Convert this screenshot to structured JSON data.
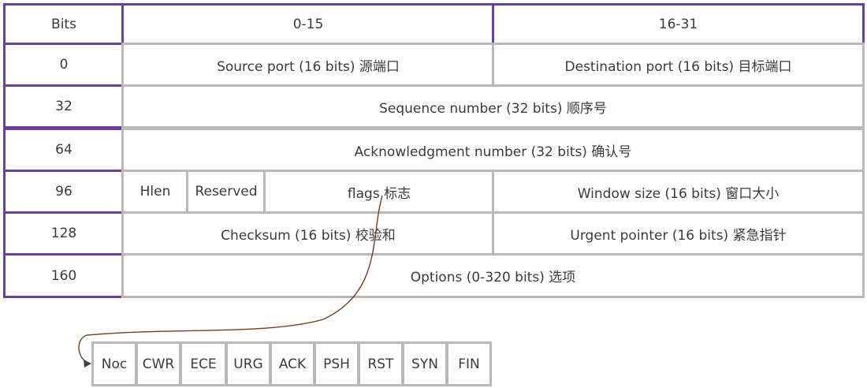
{
  "header": {
    "bits_label": "Bits",
    "col_a": "0-15",
    "col_b": "16-31"
  },
  "rows": [
    {
      "offset": "0",
      "fields": [
        "Source port (16 bits) 源端口",
        "Destination port (16 bits) 目标端口"
      ]
    },
    {
      "offset": "32",
      "fields": [
        "Sequence number (32 bits) 顺序号"
      ]
    },
    {
      "offset": "64",
      "fields": [
        "Acknowledgment number (32 bits) 确认号"
      ]
    },
    {
      "offset": "96",
      "fields": [
        "Hlen",
        "Reserved",
        "flags 标志",
        "Window size (16 bits) 窗口大小"
      ]
    },
    {
      "offset": "128",
      "fields": [
        "Checksum (16 bits) 校验和",
        "Urgent pointer (16 bits) 紧急指针"
      ]
    },
    {
      "offset": "160",
      "fields": [
        "Options (0-320 bits) 选项"
      ]
    }
  ],
  "flags": [
    "Noc",
    "CWR",
    "ECE",
    "URG",
    "ACK",
    "PSH",
    "RST",
    "SYN",
    "FIN"
  ],
  "colors": {
    "header_border": "#6b3fa0",
    "cell_border": "#b9b9b9",
    "connector": "#7a3b1e"
  }
}
